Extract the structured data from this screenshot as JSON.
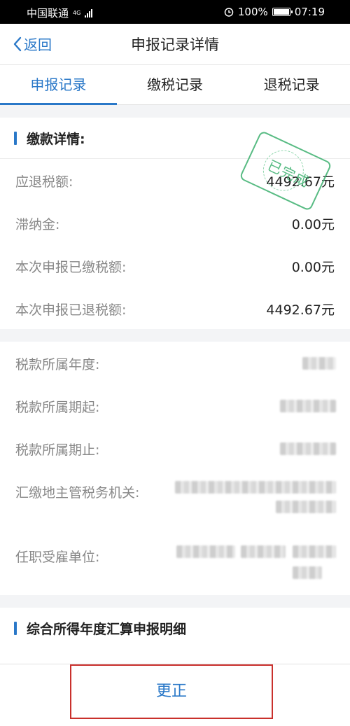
{
  "status_bar": {
    "carrier": "中国联通",
    "network": "4G",
    "battery": "100%",
    "time": "07:19"
  },
  "nav": {
    "back_label": "返回",
    "title": "申报记录详情"
  },
  "tabs": [
    {
      "label": "申报记录",
      "active": true
    },
    {
      "label": "缴税记录",
      "active": false
    },
    {
      "label": "退税记录",
      "active": false
    }
  ],
  "payment_section": {
    "title": "缴款详情:",
    "stamp_text": "已完成",
    "rows": [
      {
        "label": "应退税额:",
        "value": "4492.67元"
      },
      {
        "label": "滞纳金:",
        "value": "0.00元"
      },
      {
        "label": "本次申报已缴税额:",
        "value": "0.00元"
      },
      {
        "label": "本次申报已退税额:",
        "value": "4492.67元"
      }
    ]
  },
  "info_section": {
    "rows": [
      {
        "label": "税款所属年度:"
      },
      {
        "label": "税款所属期起:"
      },
      {
        "label": "税款所属期止:"
      },
      {
        "label": "汇缴地主管税务机关:"
      },
      {
        "label": "任职受雇单位:"
      }
    ]
  },
  "summary_section": {
    "title": "综合所得年度汇算申报明细"
  },
  "bottom": {
    "correct_label": "更正"
  },
  "colors": {
    "accent": "#2a78c8",
    "stamp": "#3bb06e",
    "highlight_border": "#c9302c"
  }
}
